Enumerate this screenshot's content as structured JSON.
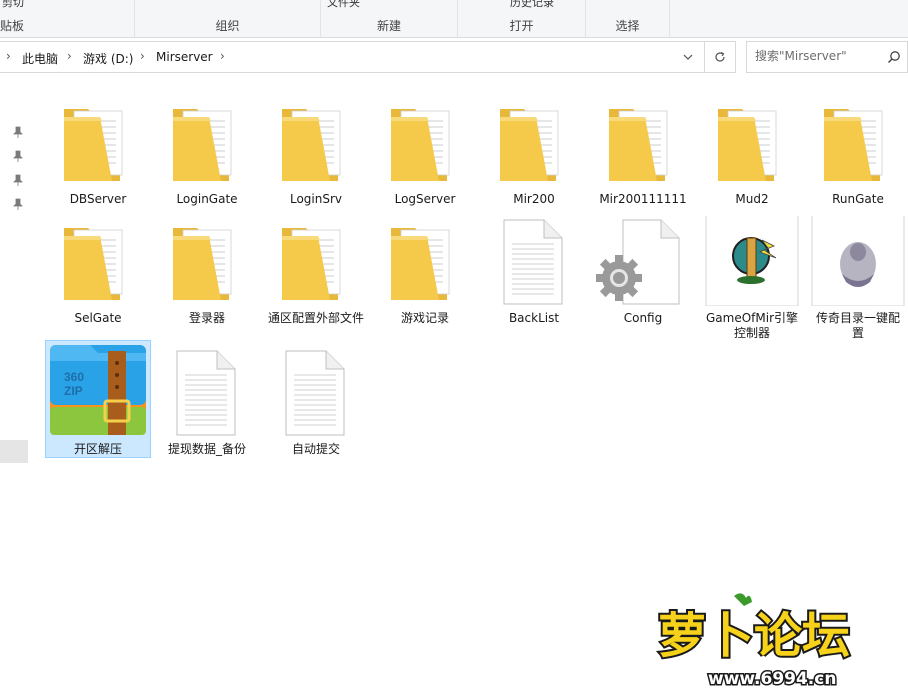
{
  "ribbon": {
    "clipboard": {
      "top_fragment": "剪切",
      "label": "贴板"
    },
    "organize": {
      "label": "组织"
    },
    "new": {
      "top_fragment": "文件夹",
      "label": "新建"
    },
    "open": {
      "top_fragment": "历史记录",
      "label": "打开"
    },
    "select": {
      "label": "选择"
    }
  },
  "address": {
    "crumbs": [
      "此电脑",
      "游戏 (D:)",
      "Mirserver"
    ]
  },
  "search": {
    "placeholder": "搜索\"Mirserver\""
  },
  "items": [
    {
      "label": "DBServer",
      "icon": "folder-icon"
    },
    {
      "label": "LoginGate",
      "icon": "folder-icon"
    },
    {
      "label": "LoginSrv",
      "icon": "folder-icon"
    },
    {
      "label": "LogServer",
      "icon": "folder-icon"
    },
    {
      "label": "Mir200",
      "icon": "folder-icon"
    },
    {
      "label": "Mir200111111",
      "icon": "folder-icon"
    },
    {
      "label": "Mud2",
      "icon": "folder-icon"
    },
    {
      "label": "RunGate",
      "icon": "folder-icon"
    },
    {
      "label": "SelGate",
      "icon": "folder-icon"
    },
    {
      "label": "登录器",
      "icon": "folder-icon"
    },
    {
      "label": "通区配置外部文件",
      "icon": "folder-icon"
    },
    {
      "label": "游戏记录",
      "icon": "folder-icon"
    },
    {
      "label": "BackList",
      "icon": "document-icon"
    },
    {
      "label": "Config",
      "icon": "config-file-icon"
    },
    {
      "label": "GameOfMir引擎控制器",
      "icon": "app-icon"
    },
    {
      "label": "传奇目录一键配置",
      "icon": "app-icon"
    },
    {
      "label": "开区解压",
      "icon": "zip-archive-icon"
    },
    {
      "label": "提现数据_备份",
      "icon": "document-icon"
    },
    {
      "label": "自动提交",
      "icon": "document-icon"
    }
  ],
  "watermark": {
    "brand": "萝卜论坛",
    "url": "www.6994.cn"
  },
  "colors": {
    "folder": "#f5c94a",
    "selection": "#cce8ff",
    "accent": "#0078d7"
  }
}
